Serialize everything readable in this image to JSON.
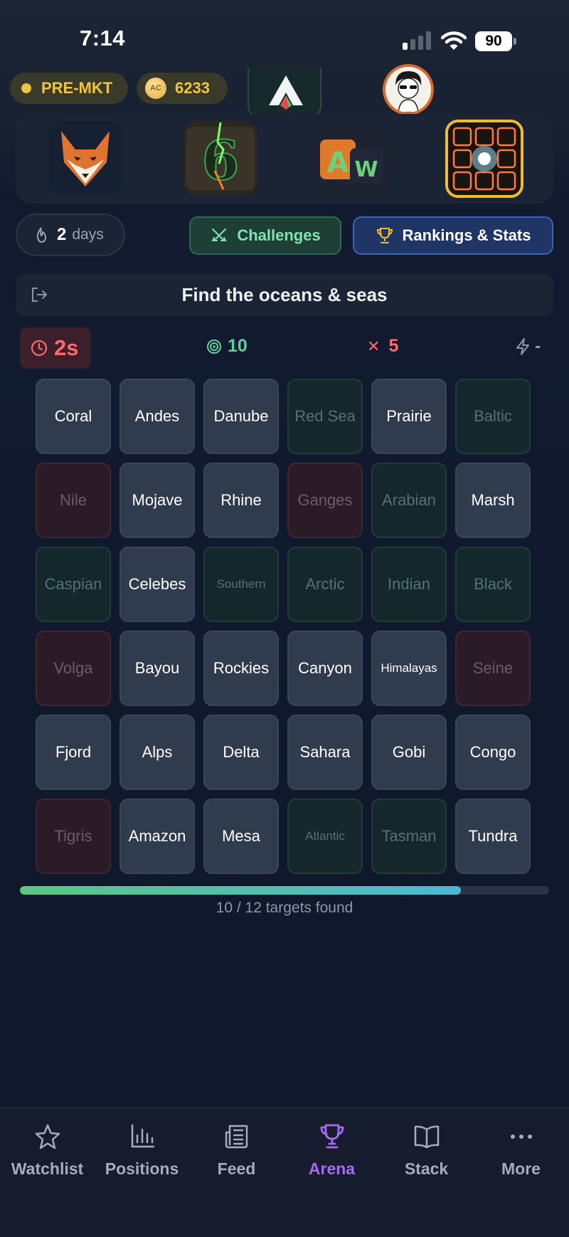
{
  "status_bar": {
    "time": "7:14",
    "battery": "90"
  },
  "header": {
    "market_status": "PRE-MKT",
    "coin_symbol": "AC",
    "coin_balance": "6233"
  },
  "games": [
    {
      "name": "fox-game",
      "selected": false
    },
    {
      "name": "six-game",
      "selected": false
    },
    {
      "name": "word-game",
      "selected": false,
      "tile_letters": "AW"
    },
    {
      "name": "grid-game",
      "selected": true
    }
  ],
  "streak": {
    "count": "2",
    "unit": "days"
  },
  "tabs": {
    "challenges": "Challenges",
    "rankings": "Rankings & Stats"
  },
  "task": {
    "prompt": "Find the oceans & seas"
  },
  "stats": {
    "timer": "2s",
    "score": "10",
    "misses": "5",
    "bonus": "-"
  },
  "grid": {
    "cells": [
      {
        "label": "Coral",
        "state": "default"
      },
      {
        "label": "Andes",
        "state": "default"
      },
      {
        "label": "Danube",
        "state": "default"
      },
      {
        "label": "Red Sea",
        "state": "found"
      },
      {
        "label": "Prairie",
        "state": "default"
      },
      {
        "label": "Baltic",
        "state": "found"
      },
      {
        "label": "Nile",
        "state": "wrong"
      },
      {
        "label": "Mojave",
        "state": "default"
      },
      {
        "label": "Rhine",
        "state": "default"
      },
      {
        "label": "Ganges",
        "state": "wrong"
      },
      {
        "label": "Arabian",
        "state": "found"
      },
      {
        "label": "Marsh",
        "state": "default"
      },
      {
        "label": "Caspian",
        "state": "found"
      },
      {
        "label": "Celebes",
        "state": "default"
      },
      {
        "label": "Southern",
        "state": "found"
      },
      {
        "label": "Arctic",
        "state": "found"
      },
      {
        "label": "Indian",
        "state": "found"
      },
      {
        "label": "Black",
        "state": "found"
      },
      {
        "label": "Volga",
        "state": "wrong"
      },
      {
        "label": "Bayou",
        "state": "default"
      },
      {
        "label": "Rockies",
        "state": "default"
      },
      {
        "label": "Canyon",
        "state": "default"
      },
      {
        "label": "Himalayas",
        "state": "default"
      },
      {
        "label": "Seine",
        "state": "wrong"
      },
      {
        "label": "Fjord",
        "state": "default"
      },
      {
        "label": "Alps",
        "state": "default"
      },
      {
        "label": "Delta",
        "state": "default"
      },
      {
        "label": "Sahara",
        "state": "default"
      },
      {
        "label": "Gobi",
        "state": "default"
      },
      {
        "label": "Congo",
        "state": "default"
      },
      {
        "label": "Tigris",
        "state": "wrong"
      },
      {
        "label": "Amazon",
        "state": "default"
      },
      {
        "label": "Mesa",
        "state": "default"
      },
      {
        "label": "Atlantic",
        "state": "found"
      },
      {
        "label": "Tasman",
        "state": "found"
      },
      {
        "label": "Tundra",
        "state": "default"
      }
    ]
  },
  "progress": {
    "fraction": 0.833,
    "label": "10 / 12 targets found"
  },
  "nav": [
    {
      "label": "Watchlist",
      "icon": "star-icon",
      "active": false
    },
    {
      "label": "Positions",
      "icon": "bar-chart-icon",
      "active": false
    },
    {
      "label": "Feed",
      "icon": "newspaper-icon",
      "active": false
    },
    {
      "label": "Arena",
      "icon": "trophy-icon",
      "active": true
    },
    {
      "label": "Stack",
      "icon": "book-icon",
      "active": false
    },
    {
      "label": "More",
      "icon": "more-icon",
      "active": false
    }
  ],
  "colors": {
    "accent_purple": "#a86bf0",
    "found_green": "#5dd39a",
    "miss_red": "#ff6a6a",
    "gold": "#f2bb34"
  }
}
